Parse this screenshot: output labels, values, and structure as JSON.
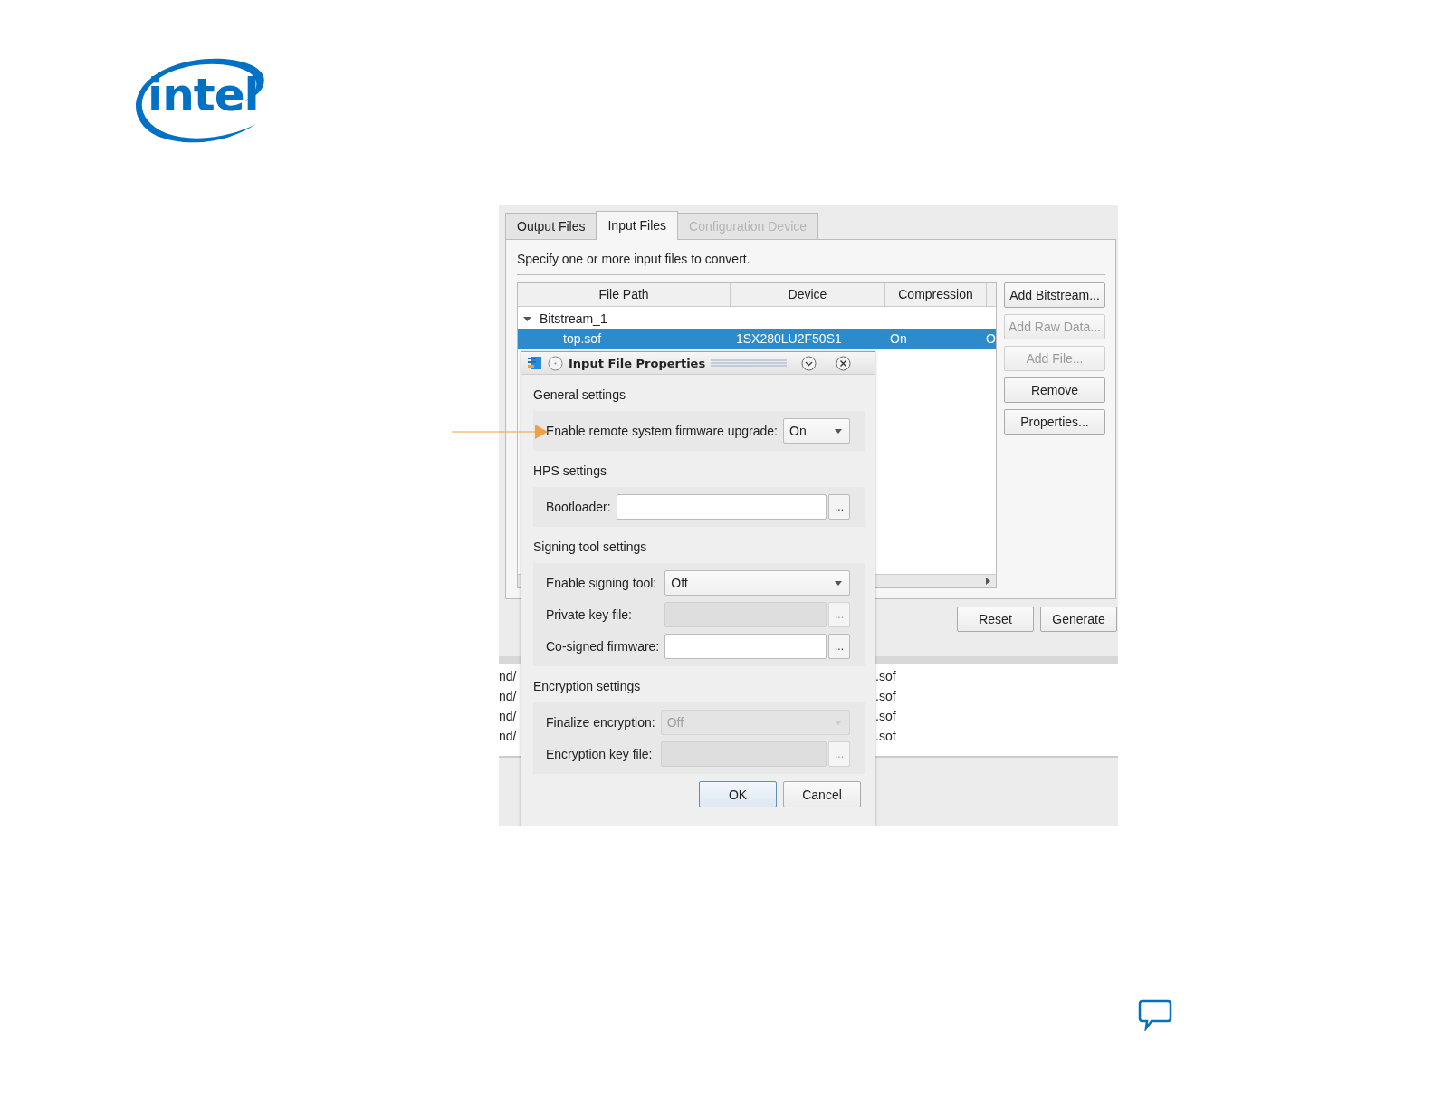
{
  "logo": {
    "text": "intel"
  },
  "window": {
    "tabs": [
      {
        "label": "Output Files",
        "selected": false,
        "disabled": false
      },
      {
        "label": "Input Files",
        "selected": true,
        "disabled": false
      },
      {
        "label": "Configuration Device",
        "selected": false,
        "disabled": true
      }
    ],
    "instruction": "Specify one or more input files to convert.",
    "table": {
      "columns": [
        "File Path",
        "Device",
        "Compression"
      ],
      "groups": [
        {
          "name": "Bitstream_1",
          "expanded": true,
          "rows": [
            {
              "cells": [
                "top.sof",
                "1SX280LU2F50S1",
                "On",
                "O"
              ],
              "selected": true
            }
          ]
        }
      ]
    },
    "side_buttons": [
      {
        "label": "Add Bitstream...",
        "disabled": false
      },
      {
        "label": "Add Raw Data...",
        "disabled": true
      },
      {
        "label": "Add File...",
        "disabled": true
      },
      {
        "label": "Remove",
        "disabled": false
      },
      {
        "label": "Properties...",
        "disabled": false
      }
    ],
    "footer_buttons": [
      "Reset",
      "Generate"
    ]
  },
  "output_list": {
    "rows": [
      {
        "column_1": "nd/",
        "column_2": ".sof"
      },
      {
        "column_1": "nd/",
        "column_2": ".sof"
      },
      {
        "column_1": "nd/",
        "column_2": ".sof"
      },
      {
        "column_1": "nd/",
        "column_2": ".sof"
      }
    ]
  },
  "dialog": {
    "title": "Input File Properties",
    "sections": [
      {
        "title": "General settings",
        "fields": [
          {
            "kind": "combo",
            "label": "Enable remote system firmware upgrade:",
            "value": "On",
            "disabled": false
          }
        ]
      },
      {
        "title": "HPS settings",
        "fields": [
          {
            "kind": "file",
            "label": "Bootloader:",
            "browse": "...",
            "disabled": false
          }
        ]
      },
      {
        "title": "Signing tool settings",
        "fields": [
          {
            "kind": "combo",
            "label": "Enable signing tool:",
            "value": "Off",
            "disabled": false
          },
          {
            "kind": "file",
            "label": "Private key file:",
            "browse": "...",
            "disabled": true
          },
          {
            "kind": "file",
            "label": "Co-signed firmware:",
            "browse": "...",
            "disabled": false
          }
        ]
      },
      {
        "title": "Encryption settings",
        "fields": [
          {
            "kind": "combo",
            "label": "Finalize encryption:",
            "value": "Off",
            "disabled": true
          },
          {
            "kind": "file",
            "label": "Encryption key file:",
            "browse": "...",
            "disabled": true
          }
        ]
      }
    ],
    "buttons": [
      {
        "label": "OK",
        "default": true
      },
      {
        "label": "Cancel",
        "default": false
      }
    ]
  }
}
